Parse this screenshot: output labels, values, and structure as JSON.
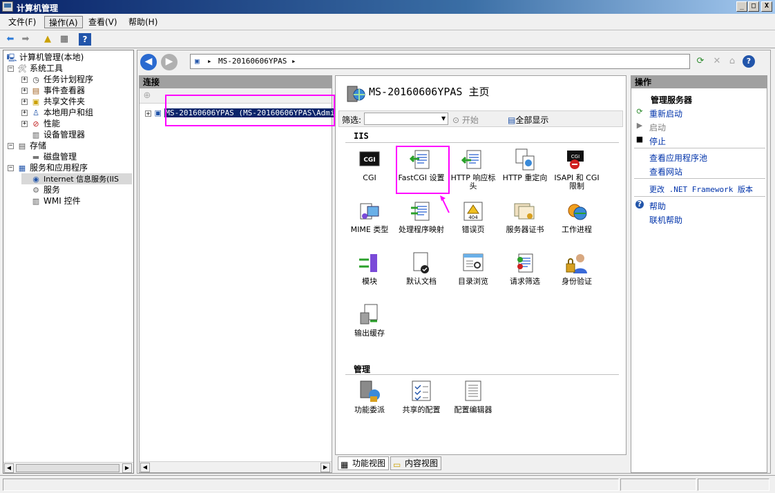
{
  "window": {
    "title": "计算机管理",
    "minimize": "_",
    "maximize": "□",
    "close": "X"
  },
  "menu": {
    "items": [
      "文件(F)",
      "操作(A)",
      "查看(V)",
      "帮助(H)"
    ]
  },
  "tree": {
    "root": "计算机管理(本地)",
    "items": [
      {
        "label": "系统工具",
        "level": 1,
        "expander": "⊟"
      },
      {
        "label": "任务计划程序",
        "level": 2,
        "expander": "⊞"
      },
      {
        "label": "事件查看器",
        "level": 2,
        "expander": "⊞"
      },
      {
        "label": "共享文件夹",
        "level": 2,
        "expander": "⊞"
      },
      {
        "label": "本地用户和组",
        "level": 2,
        "expander": "⊞"
      },
      {
        "label": "性能",
        "level": 2,
        "expander": "⊞"
      },
      {
        "label": "设备管理器",
        "level": 2,
        "expander": ""
      },
      {
        "label": "存储",
        "level": 1,
        "expander": "⊟"
      },
      {
        "label": "磁盘管理",
        "level": 2,
        "expander": ""
      },
      {
        "label": "服务和应用程序",
        "level": 1,
        "expander": "⊟"
      },
      {
        "label": "Internet 信息服务(IIS",
        "level": 2,
        "expander": ""
      },
      {
        "label": "服务",
        "level": 2,
        "expander": ""
      },
      {
        "label": "WMI 控件",
        "level": 2,
        "expander": ""
      }
    ]
  },
  "address": {
    "crumb": "MS-20160606YPAS",
    "arrow": "▸"
  },
  "connections": {
    "header": "连接",
    "node": "MS-20160606YPAS (MS-20160606YPAS\\Admini"
  },
  "center": {
    "title": "MS-20160606YPAS 主页",
    "filter_label": "筛选:",
    "start_label": "开始",
    "show_all_label": "全部显示",
    "section_iis": "IIS",
    "section_manage": "管理",
    "iis_features": [
      {
        "label": "CGI",
        "icon": "cgi-icon"
      },
      {
        "label": "FastCGI 设置",
        "icon": "fastcgi-icon"
      },
      {
        "label": "HTTP 响应标头",
        "icon": "http-headers-icon"
      },
      {
        "label": "HTTP 重定向",
        "icon": "http-redirect-icon"
      },
      {
        "label": "ISAPI 和 CGI 限制",
        "icon": "isapi-cgi-icon"
      },
      {
        "label": "MIME 类型",
        "icon": "mime-icon"
      },
      {
        "label": "处理程序映射",
        "icon": "handler-mapping-icon"
      },
      {
        "label": "错误页",
        "icon": "error-page-icon"
      },
      {
        "label": "服务器证书",
        "icon": "certificate-icon"
      },
      {
        "label": "工作进程",
        "icon": "worker-process-icon"
      },
      {
        "label": "模块",
        "icon": "modules-icon"
      },
      {
        "label": "默认文档",
        "icon": "default-document-icon"
      },
      {
        "label": "目录浏览",
        "icon": "directory-browsing-icon"
      },
      {
        "label": "请求筛选",
        "icon": "request-filtering-icon"
      },
      {
        "label": "身份验证",
        "icon": "authentication-icon"
      },
      {
        "label": "输出缓存",
        "icon": "output-cache-icon"
      }
    ],
    "manage_features": [
      {
        "label": "功能委派",
        "icon": "feature-delegation-icon"
      },
      {
        "label": "共享的配置",
        "icon": "shared-config-icon"
      },
      {
        "label": "配置编辑器",
        "icon": "config-editor-icon"
      }
    ],
    "tabs": [
      "功能视图",
      "内容视图"
    ]
  },
  "actions": {
    "header": "操作",
    "group_manage_server": "管理服务器",
    "restart": "重新启动",
    "start": "启动",
    "stop": "停止",
    "view_app_pools": "查看应用程序池",
    "view_sites": "查看网站",
    "change_net": "更改 .NET Framework 版本",
    "help": "帮助",
    "online_help": "联机帮助"
  },
  "colors": {
    "highlight": "#ff00ff",
    "link": "#0033aa"
  }
}
